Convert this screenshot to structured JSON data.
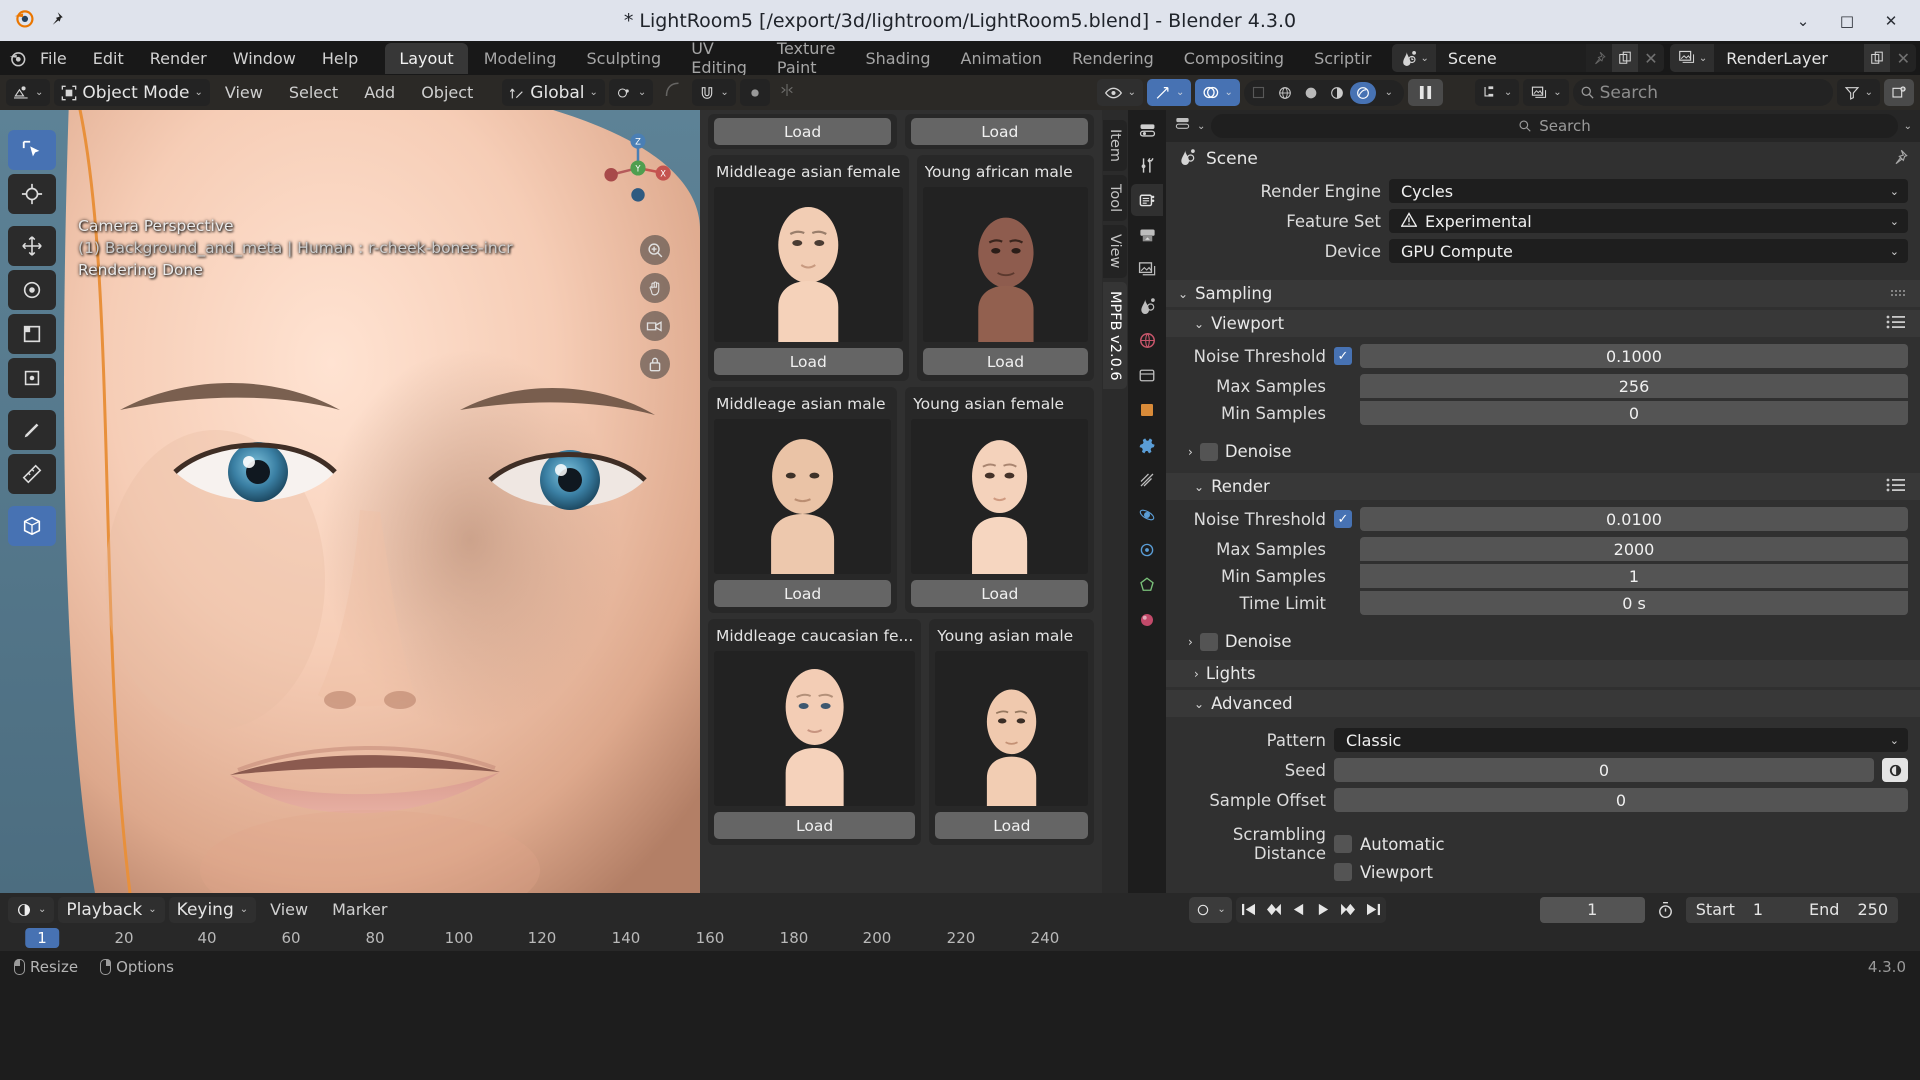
{
  "titlebar": {
    "title": "* LightRoom5 [/export/3d/lightroom/LightRoom5.blend] - Blender 4.3.0",
    "minimize": "⌄",
    "maximize": "□",
    "close": "✕"
  },
  "menubar": {
    "items": [
      "File",
      "Edit",
      "Render",
      "Window",
      "Help"
    ],
    "workspaces": [
      {
        "label": "Layout",
        "active": true
      },
      {
        "label": "Modeling",
        "active": false
      },
      {
        "label": "Sculpting",
        "active": false
      },
      {
        "label": "UV Editing",
        "active": false
      },
      {
        "label": "Texture Paint",
        "active": false
      },
      {
        "label": "Shading",
        "active": false
      },
      {
        "label": "Animation",
        "active": false
      },
      {
        "label": "Rendering",
        "active": false
      },
      {
        "label": "Compositing",
        "active": false
      },
      {
        "label": "Scriptir",
        "active": false
      }
    ],
    "scene_name": "Scene",
    "viewlayer_name": "RenderLayer"
  },
  "viewport_header": {
    "mode": "Object Mode",
    "menus": [
      "View",
      "Select",
      "Add",
      "Object"
    ],
    "transform_orientation": "Global"
  },
  "viewport": {
    "line1": "Camera Perspective",
    "line2": "(1) Background_and_meta | Human : r-cheek-bones-incr",
    "line3": "Rendering Done",
    "gizmo_axes": [
      "Z",
      "Y",
      "X"
    ]
  },
  "mpfb": {
    "sidebar_tabs": [
      {
        "label": "Item",
        "active": false
      },
      {
        "label": "Tool",
        "active": false
      },
      {
        "label": "View",
        "active": false
      },
      {
        "label": "MPFB v2.0.6",
        "active": true
      }
    ],
    "load_label": "Load",
    "top_buttons": [
      "Load",
      "Load"
    ],
    "assets": [
      {
        "name": "Middleage asian female",
        "load": "Load",
        "skin": "#f2cdb4",
        "shade": "#d9a98e"
      },
      {
        "name": "Young african male",
        "load": "Load",
        "skin": "#8e5c4e",
        "shade": "#6d4238"
      },
      {
        "name": "Middleage asian male",
        "load": "Load",
        "skin": "#eac3a6",
        "shade": "#cf9f82"
      },
      {
        "name": "Young asian female",
        "load": "Load",
        "skin": "#f4d2bb",
        "shade": "#dcae93"
      },
      {
        "name": "Middleage caucasian fe...",
        "load": "Load",
        "skin": "#f3cdb5",
        "shade": "#d8a98e"
      },
      {
        "name": "Young asian male",
        "load": "Load",
        "skin": "#f0c9ae",
        "shade": "#d5a589"
      }
    ]
  },
  "properties": {
    "search_placeholder": "Search",
    "breadcrumb": "Scene",
    "render_engine_label": "Render Engine",
    "render_engine_value": "Cycles",
    "feature_set_label": "Feature Set",
    "feature_set_value": "Experimental",
    "device_label": "Device",
    "device_value": "GPU Compute",
    "sampling_panel": "Sampling",
    "viewport_panel": "Viewport",
    "viewport_noise_threshold_label": "Noise Threshold",
    "viewport_noise_threshold_value": "0.1000",
    "viewport_noise_threshold_checked": true,
    "viewport_max_samples_label": "Max Samples",
    "viewport_max_samples_value": "256",
    "viewport_min_samples_label": "Min Samples",
    "viewport_min_samples_value": "0",
    "viewport_denoise_label": "Denoise",
    "viewport_denoise_checked": false,
    "render_panel": "Render",
    "render_noise_threshold_label": "Noise Threshold",
    "render_noise_threshold_value": "0.0100",
    "render_noise_threshold_checked": true,
    "render_max_samples_label": "Max Samples",
    "render_max_samples_value": "2000",
    "render_min_samples_label": "Min Samples",
    "render_min_samples_value": "1",
    "time_limit_label": "Time Limit",
    "time_limit_value": "0 s",
    "render_denoise_label": "Denoise",
    "render_denoise_checked": false,
    "lights_panel": "Lights",
    "advanced_panel": "Advanced",
    "pattern_label": "Pattern",
    "pattern_value": "Classic",
    "seed_label": "Seed",
    "seed_value": "0",
    "sample_offset_label": "Sample Offset",
    "sample_offset_value": "0",
    "scrambling_distance_label": "Scrambling Distance",
    "scrambling_automatic_label": "Automatic",
    "scrambling_viewport_label": "Viewport"
  },
  "search_top": {
    "placeholder": "Search"
  },
  "timeline": {
    "menus": [
      "Playback",
      "Keying",
      "View",
      "Marker"
    ],
    "current_frame": "1",
    "start_label": "Start",
    "start_value": "1",
    "end_label": "End",
    "end_value": "250",
    "ticks": [
      "20",
      "40",
      "60",
      "80",
      "100",
      "120",
      "140",
      "160",
      "180",
      "200",
      "220",
      "240"
    ],
    "playhead": "1"
  },
  "status": {
    "resize": "Resize",
    "options": "Options",
    "version": "4.3.0"
  },
  "colors": {
    "accent_blue": "#4772b3",
    "panel_bg": "#303030",
    "header_bg": "#181818",
    "titlebar_bg": "#dfe3ec",
    "sidebar_highlight": "#73a6bf"
  }
}
